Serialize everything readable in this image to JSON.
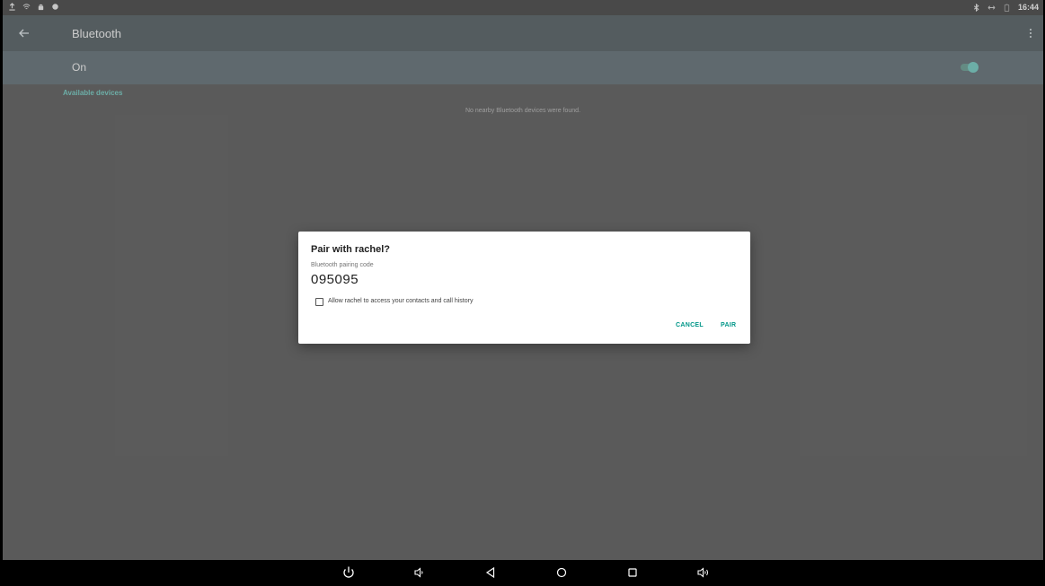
{
  "status_bar": {
    "left_icons": [
      "upload-icon",
      "wifi-icon",
      "android-icon",
      "notification-dot-icon"
    ],
    "right_icons": [
      "bluetooth-icon",
      "data-transfer-icon",
      "battery-icon"
    ],
    "time": "16:44"
  },
  "app_bar": {
    "title": "Bluetooth",
    "back_icon": "arrow-back-icon",
    "menu_icon": "more-vert-icon"
  },
  "switch_bar": {
    "label": "On",
    "toggle_on": true
  },
  "content": {
    "section_header": "Available devices",
    "empty_message": "No nearby Bluetooth devices were found."
  },
  "dialog": {
    "title": "Pair with rachel?",
    "code_label": "Bluetooth pairing code",
    "code_value": "095095",
    "checkbox_label": "Allow rachel to access your contacts and call history",
    "checkbox_checked": false,
    "cancel_label": "CANCEL",
    "pair_label": "PAIR"
  },
  "nav_bar": {
    "icons": [
      "power-icon",
      "volume-down-icon",
      "back-icon",
      "home-icon",
      "recents-icon",
      "volume-up-icon"
    ]
  },
  "colors": {
    "accent": "#009688",
    "toggle": "#4db6ac",
    "app_bar": "#263238",
    "switch_bar": "#37474f"
  }
}
